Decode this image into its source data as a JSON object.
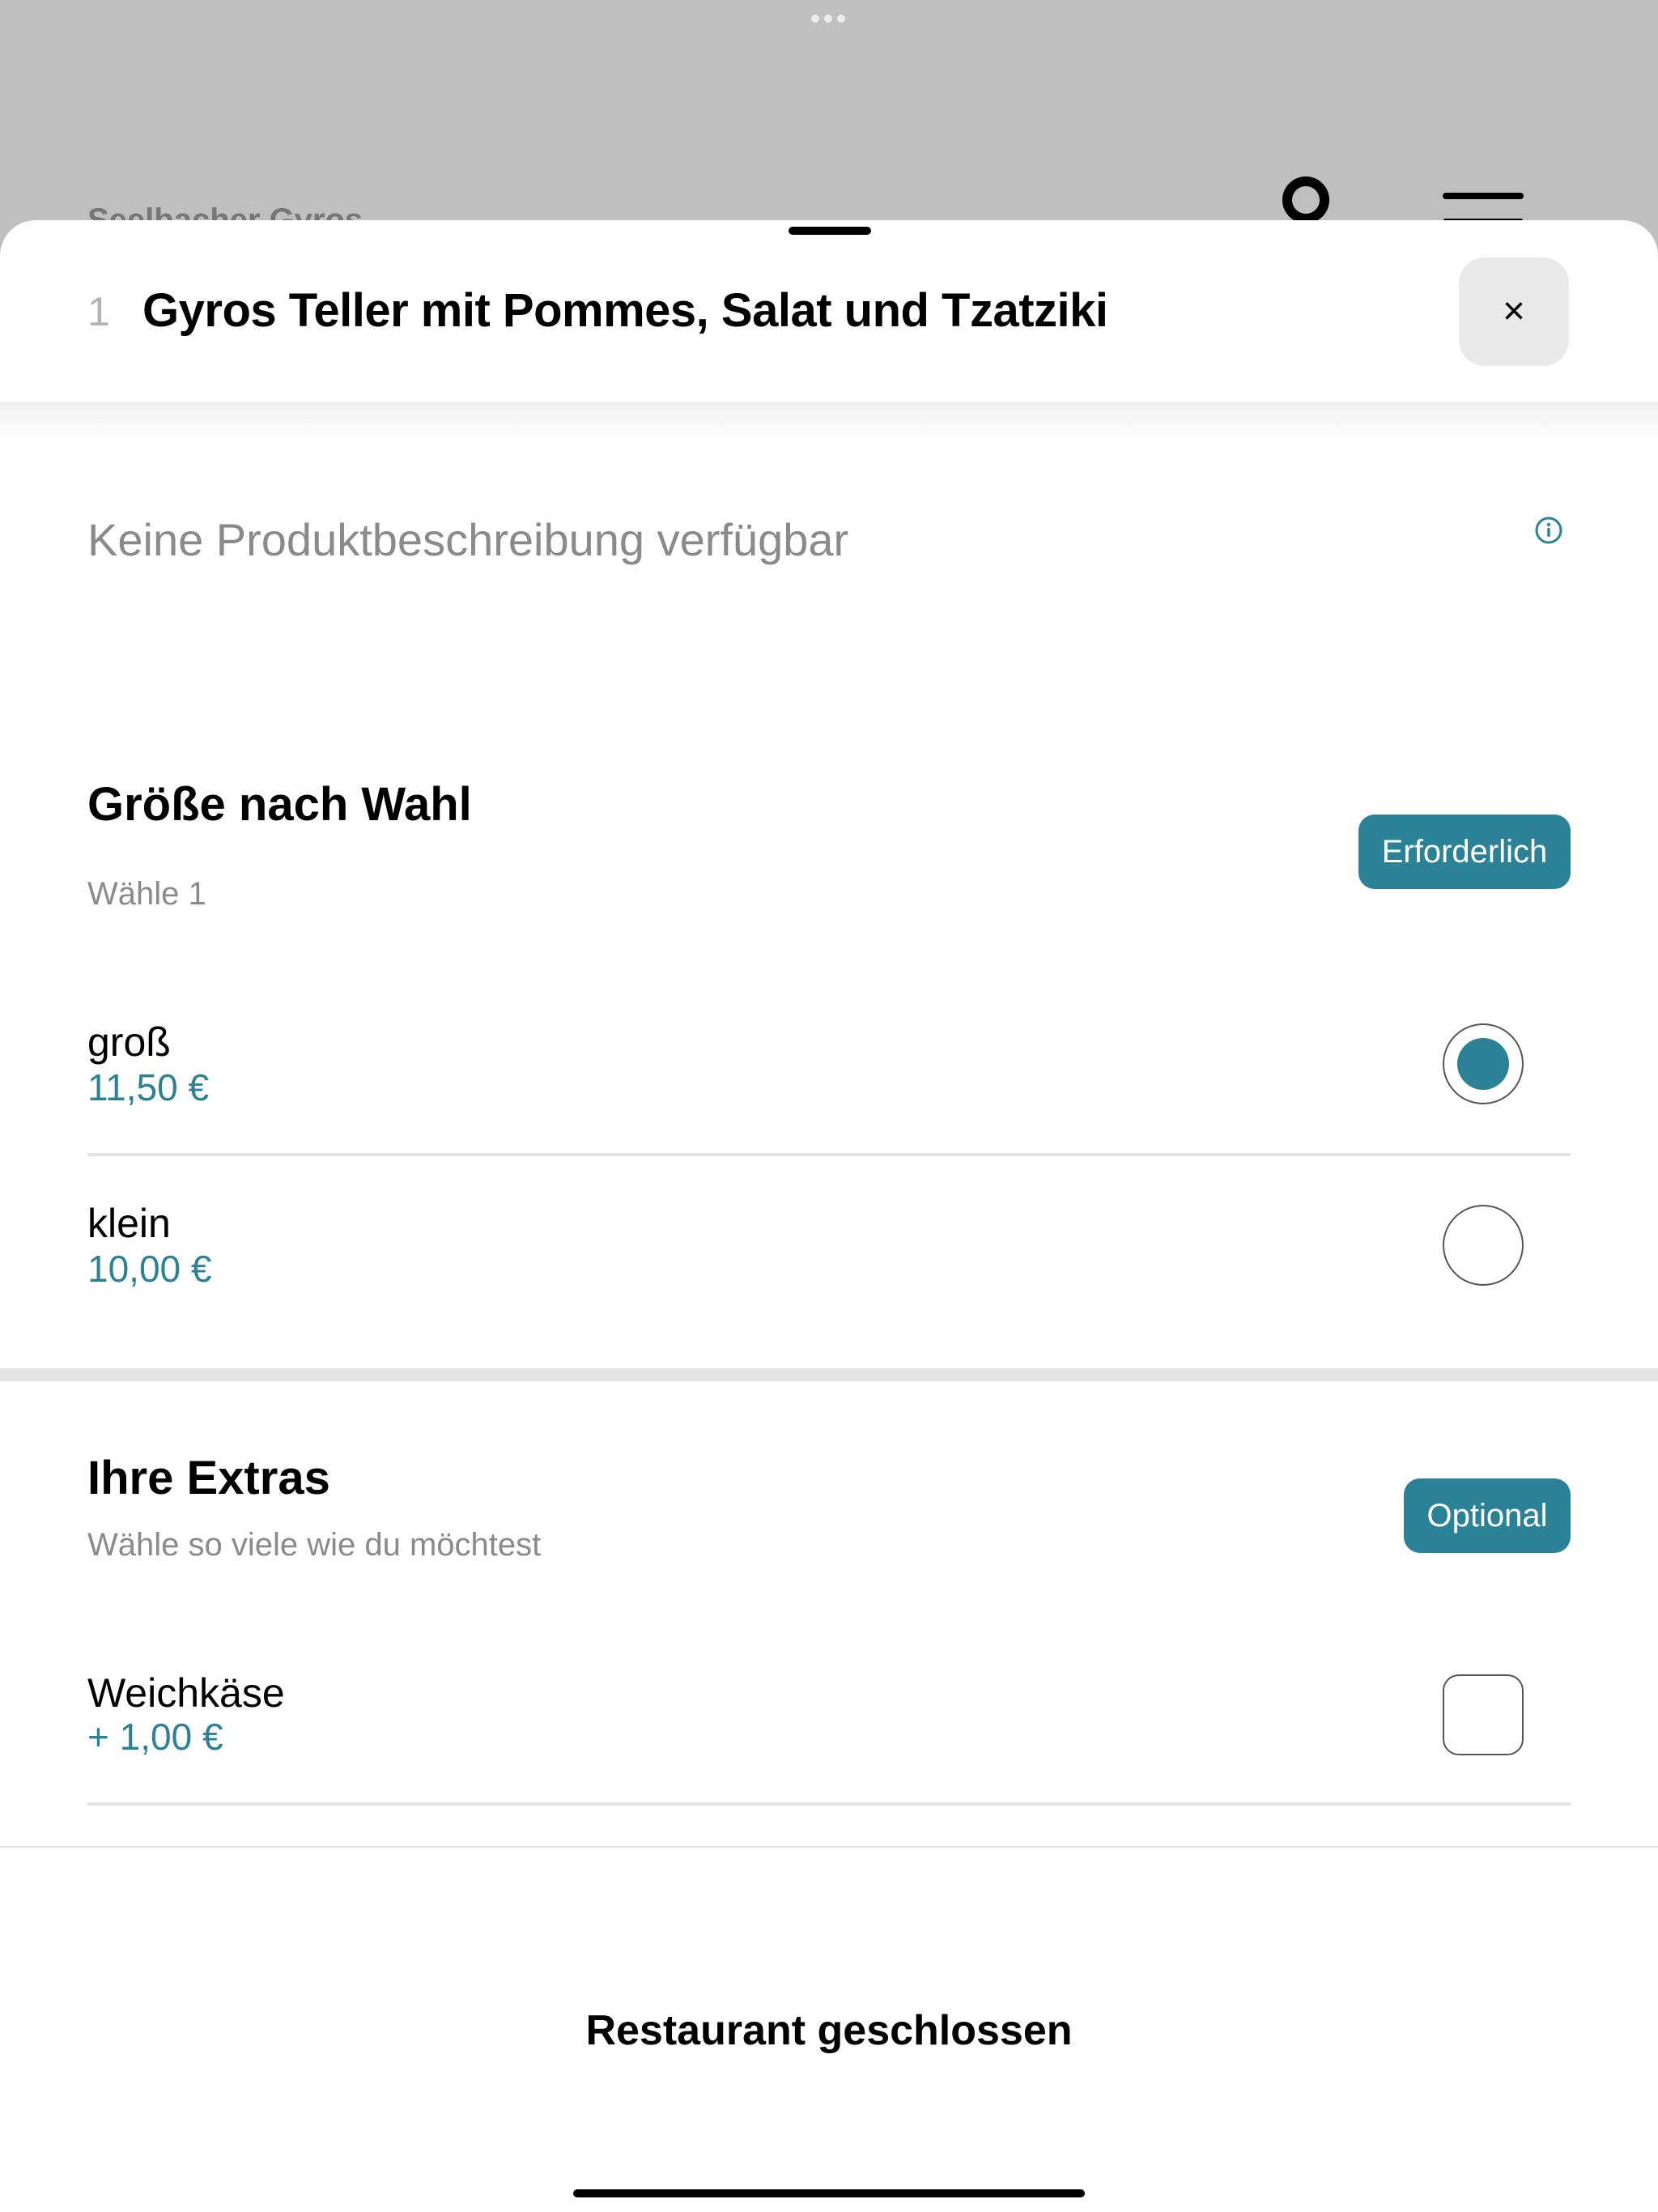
{
  "background": {
    "restaurant_name": "Seelbacher Gyros"
  },
  "item": {
    "quantity": "1",
    "title": "Gyros Teller mit Pommes, Salat und Tzatziki",
    "close_label": "×",
    "description": "Keine Produktbeschreibung verfügbar"
  },
  "size_group": {
    "title": "Größe nach Wahl",
    "subtitle": "Wähle 1",
    "badge": "Erforderlich",
    "options": [
      {
        "name": "groß",
        "price": "11,50 €",
        "selected": true
      },
      {
        "name": "klein",
        "price": "10,00 €",
        "selected": false
      }
    ]
  },
  "extras_group": {
    "title": "Ihre Extras",
    "subtitle": "Wähle so viele wie du möchtest",
    "badge": "Optional",
    "options": [
      {
        "name": "Weichkäse",
        "price": "+ 1,00 €",
        "checked": false
      }
    ]
  },
  "footer": {
    "status": "Restaurant geschlossen"
  },
  "colors": {
    "accent": "#2b8296",
    "overlay": "#bfbfbf"
  },
  "icons": {
    "close": "close-icon",
    "info": "info-icon",
    "account": "account-icon",
    "menu": "menu-icon"
  }
}
